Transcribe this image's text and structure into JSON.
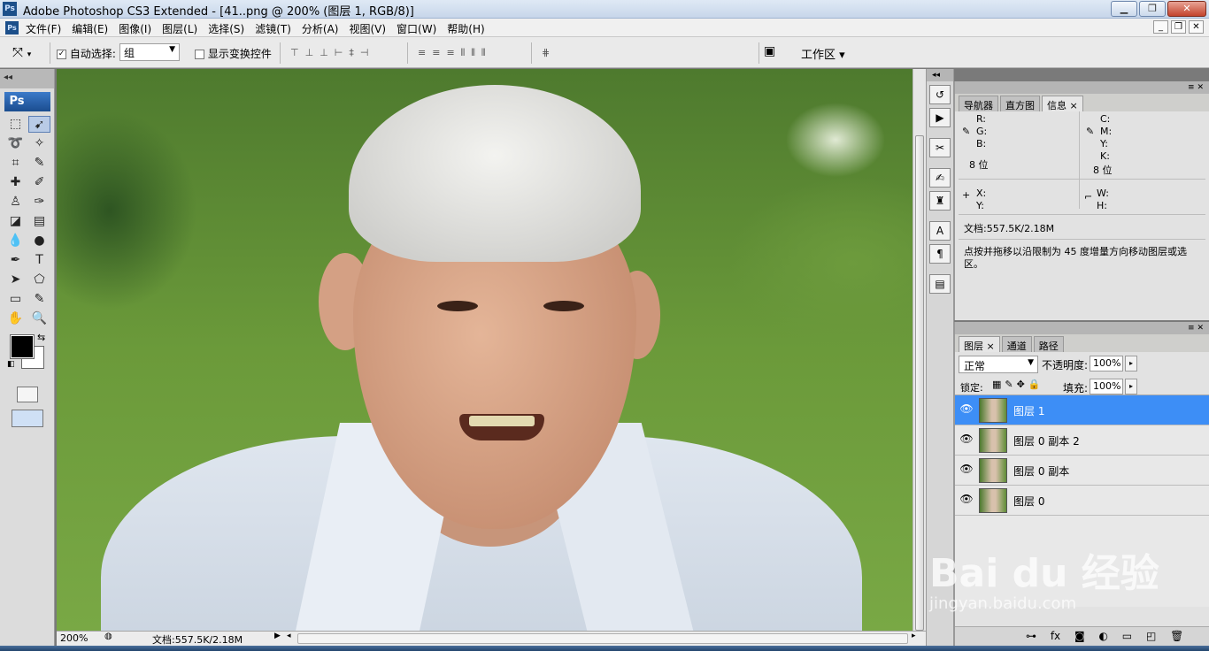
{
  "window": {
    "app_icon": "Ps",
    "title": "Adobe Photoshop CS3 Extended - [41..png @ 200% (图层 1, RGB/8)]"
  },
  "menu": {
    "items": [
      "文件(F)",
      "编辑(E)",
      "图像(I)",
      "图层(L)",
      "选择(S)",
      "滤镜(T)",
      "分析(A)",
      "视图(V)",
      "窗口(W)",
      "帮助(H)"
    ]
  },
  "options": {
    "auto_select_label": "自动选择:",
    "auto_select_value": "组",
    "show_transform_label": "显示变换控件",
    "workspace_label": "工作区 ▾"
  },
  "toolbox": {
    "logo": "Ps"
  },
  "status": {
    "zoom": "200%",
    "doc_info": "文档:557.5K/2.18M"
  },
  "info_panel": {
    "tabs": [
      "导航器",
      "直方图",
      "信息 ×"
    ],
    "r": "R:",
    "g": "G:",
    "b": "B:",
    "c": "C:",
    "m": "M:",
    "y": "Y:",
    "k": "K:",
    "bits_left": "8 位",
    "bits_right": "8 位",
    "x": "X:",
    "y2": "Y:",
    "w": "W:",
    "h": "H:",
    "doc_info": "文档:557.5K/2.18M",
    "hint": "点按并拖移以沿限制为 45 度增量方向移动图层或选区。"
  },
  "layers_panel": {
    "tabs": [
      "图层 ×",
      "通道",
      "路径"
    ],
    "blend_mode": "正常",
    "opacity_label": "不透明度:",
    "opacity_value": "100%",
    "lock_label": "锁定:",
    "fill_label": "填充:",
    "fill_value": "100%",
    "layers": [
      {
        "name": "图层 1"
      },
      {
        "name": "图层 0 副本 2"
      },
      {
        "name": "图层 0 副本"
      },
      {
        "name": "图层 0"
      }
    ]
  },
  "watermark": {
    "logo": "Bai du 经验",
    "url": "jingyan.baidu.com"
  }
}
